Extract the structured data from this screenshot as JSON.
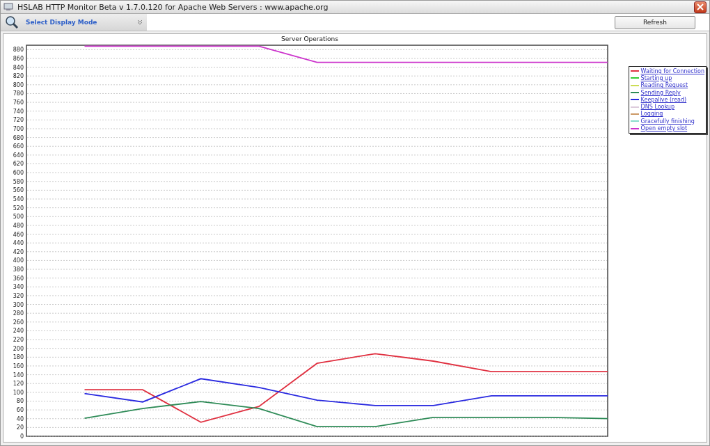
{
  "window": {
    "title": "HSLAB HTTP Monitor Beta v 1.7.0.120 for Apache Web Servers : www.apache.org"
  },
  "toolbar": {
    "mode_label": "Select Display Mode",
    "refresh_button": "Refresh"
  },
  "chart": {
    "chart_data": {
      "type": "line",
      "title": "Server Operations",
      "categories": [
        null,
        null,
        null,
        null,
        null,
        null,
        null,
        null,
        null,
        null
      ],
      "ylim": [
        0,
        890
      ],
      "grid": "y",
      "legend": "right",
      "yticks": [
        0,
        20,
        40,
        60,
        80,
        100,
        120,
        140,
        160,
        180,
        200,
        220,
        240,
        260,
        280,
        300,
        320,
        340,
        360,
        380,
        400,
        420,
        440,
        460,
        480,
        500,
        520,
        540,
        560,
        580,
        600,
        620,
        640,
        660,
        680,
        700,
        720,
        740,
        760,
        780,
        800,
        820,
        840,
        860,
        880
      ],
      "series": [
        {
          "name": "Waiting for Connection",
          "color": "#e03040",
          "values": [
            106,
            106,
            32,
            68,
            166,
            188,
            171,
            147,
            147,
            147
          ]
        },
        {
          "name": "Starting up",
          "color": "#33cc33",
          "values": [
            null,
            null,
            null,
            null,
            null,
            null,
            null,
            null,
            null,
            null
          ]
        },
        {
          "name": "Reading Request",
          "color": "#ccdd55",
          "values": [
            null,
            null,
            null,
            null,
            null,
            null,
            null,
            null,
            null,
            null
          ]
        },
        {
          "name": "Sending Reply",
          "color": "#2e8b57",
          "values": [
            41,
            63,
            79,
            63,
            22,
            22,
            43,
            43,
            43,
            40
          ]
        },
        {
          "name": "Keepalive (read)",
          "color": "#2a2ae0",
          "values": [
            97,
            78,
            131,
            111,
            82,
            70,
            70,
            92,
            92,
            92
          ]
        },
        {
          "name": "DNS Lookup",
          "color": "#ddccdd",
          "values": [
            null,
            null,
            null,
            null,
            null,
            null,
            null,
            null,
            null,
            null
          ]
        },
        {
          "name": "Logging",
          "color": "#cc9966",
          "values": [
            null,
            null,
            null,
            null,
            null,
            null,
            null,
            null,
            null,
            null
          ]
        },
        {
          "name": "Gracefully finishing",
          "color": "#88ddcc",
          "values": [
            null,
            null,
            null,
            null,
            null,
            null,
            null,
            null,
            null,
            null
          ]
        },
        {
          "name": "Open empty slot",
          "color": "#cc33cc",
          "values": [
            888,
            888,
            888,
            888,
            851,
            851,
            851,
            851,
            851,
            851
          ]
        }
      ]
    }
  }
}
